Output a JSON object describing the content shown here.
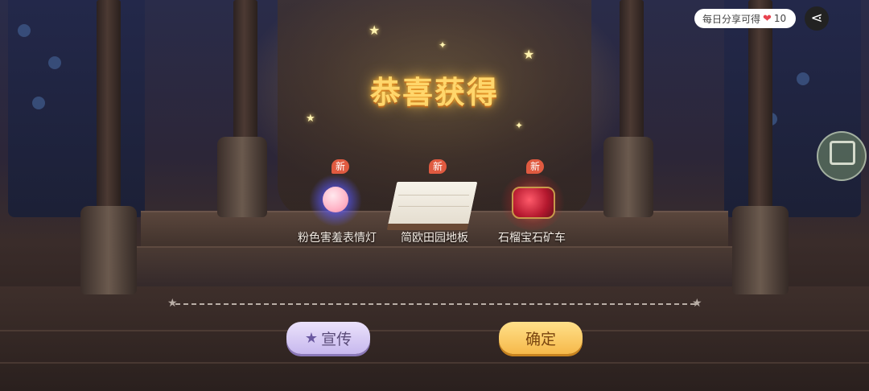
{
  "title": "恭喜获得",
  "new_badge": "新",
  "items": [
    {
      "name": "粉色害羞表情灯",
      "icon": "pink-shy-face-lamp-icon"
    },
    {
      "name": "简欧田园地板",
      "icon": "european-pastoral-floor-icon"
    },
    {
      "name": "石榴宝石矿车",
      "icon": "garnet-gem-minecart-icon"
    }
  ],
  "share_reward": {
    "text": "每日分享可得",
    "amount": "10",
    "icon": "heart-icon"
  },
  "buttons": {
    "share_label": "宣传",
    "confirm_label": "确定"
  },
  "colors": {
    "title_gold": "#ffd66b",
    "badge_red": "#e05a40",
    "share_button": "#c7b8ee",
    "confirm_button": "#f6b94a"
  }
}
